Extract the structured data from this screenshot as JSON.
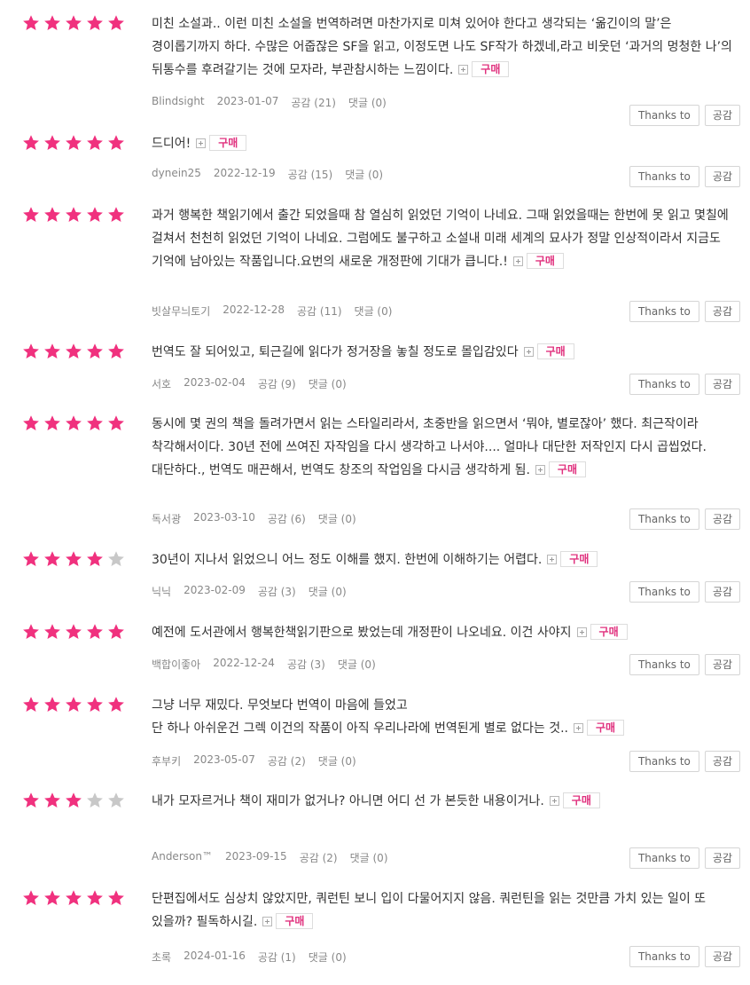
{
  "colors": {
    "star_filled": "#f0317e",
    "star_empty": "#c8c8c8",
    "buy_badge": "#e0317e"
  },
  "labels": {
    "buy": "구매",
    "thanks": "Thanks to",
    "empathy": "공감"
  },
  "reviews": [
    {
      "rating": 5,
      "text": "미친 소설과.. 이런 미친 소설을 번역하려면 마찬가지로 미쳐 있어야 한다고 생각되는 ‘옮긴이의 말’은 경이롭기까지 하다. 수많은 어줍잖은 SF을 읽고, 이정도면 나도 SF작가 하겠네,라고 비웃던 ‘과거의 멍청한 나’의 뒤통수를 후려갈기는 것에 모자라, 부관참시하는 느낌이다.",
      "author": "Blindsight",
      "date": "2023-01-07",
      "likes": "공감 (21)",
      "comments": "댓글 (0)"
    },
    {
      "rating": 5,
      "text": "드디어!",
      "author": "dynein25",
      "date": "2022-12-19",
      "likes": "공감 (15)",
      "comments": "댓글 (0)"
    },
    {
      "rating": 5,
      "text": "과거 행복한 책읽기에서 출간 되었을때 참 열심히 읽었던 기억이 나네요. 그때 읽었을때는 한번에 못 읽고 몇칠에 걸쳐서 천천히 읽었던 기억이 나네요. 그럼에도 불구하고 소설내 미래 세계의 묘사가 정말 인상적이라서 지금도 기억에 남아있는 작품입니다.요번의 새로운 개정판에 기대가 큽니다.!",
      "author": "빗살무늬토기",
      "date": "2022-12-28",
      "likes": "공감 (11)",
      "comments": "댓글 (0)"
    },
    {
      "rating": 5,
      "text": "번역도 잘 되어있고, 퇴근길에 읽다가 정거장을 놓칠 정도로 몰입감있다",
      "author": "서호",
      "date": "2023-02-04",
      "likes": "공감 (9)",
      "comments": "댓글 (0)"
    },
    {
      "rating": 5,
      "text": "동시에 몇 권의 책을 돌려가면서 읽는 스타일리라서, 초중반을 읽으면서 ‘뭐야, 별로잖아’ 했다. 최근작이라 착각해서이다. 30년 전에 쓰여진 자작임을 다시 생각하고 나서야.... 얼마나 대단한 저작인지 다시 곱씹었다. 대단하다., 번역도 매끈해서, 번역도 창조의 작업임을 다시금 생각하게 됨.",
      "author": "독서광",
      "date": "2023-03-10",
      "likes": "공감 (6)",
      "comments": "댓글 (0)"
    },
    {
      "rating": 4,
      "text": "30년이 지나서 읽었으니 어느 정도 이해를 했지. 한번에 이해하기는 어렵다.",
      "author": "닉닉",
      "date": "2023-02-09",
      "likes": "공감 (3)",
      "comments": "댓글 (0)"
    },
    {
      "rating": 5,
      "text": "예전에 도서관에서 행복한책읽기판으로 봤었는데 개정판이 나오네요. 이건 사야지",
      "author": "백합이좋아",
      "date": "2022-12-24",
      "likes": "공감 (3)",
      "comments": "댓글 (0)"
    },
    {
      "rating": 5,
      "text": "그냥 너무 재밌다. 무엇보다 번역이 마음에 들었고\n단 하나 아쉬운건 그렉 이건의 작품이 아직 우리나라에 번역된게 별로 없다는 것..",
      "author": "후부키",
      "date": "2023-05-07",
      "likes": "공감 (2)",
      "comments": "댓글 (0)"
    },
    {
      "rating": 3,
      "text": "내가 모자르거나 책이 재미가 없거나? 아니면 어디 선 가 본듯한 내용이거나.",
      "author": "Anderson™",
      "date": "2023-09-15",
      "likes": "공감 (2)",
      "comments": "댓글 (0)"
    },
    {
      "rating": 5,
      "text": "단편집에서도 심상치 않았지만, 쿼런틴 보니 입이 다물어지지 않음. 쿼런틴을 읽는 것만큼 가치 있는 일이 또 있을까? 필독하시길.",
      "author": "초록",
      "date": "2024-01-16",
      "likes": "공감 (1)",
      "comments": "댓글 (0)"
    }
  ]
}
